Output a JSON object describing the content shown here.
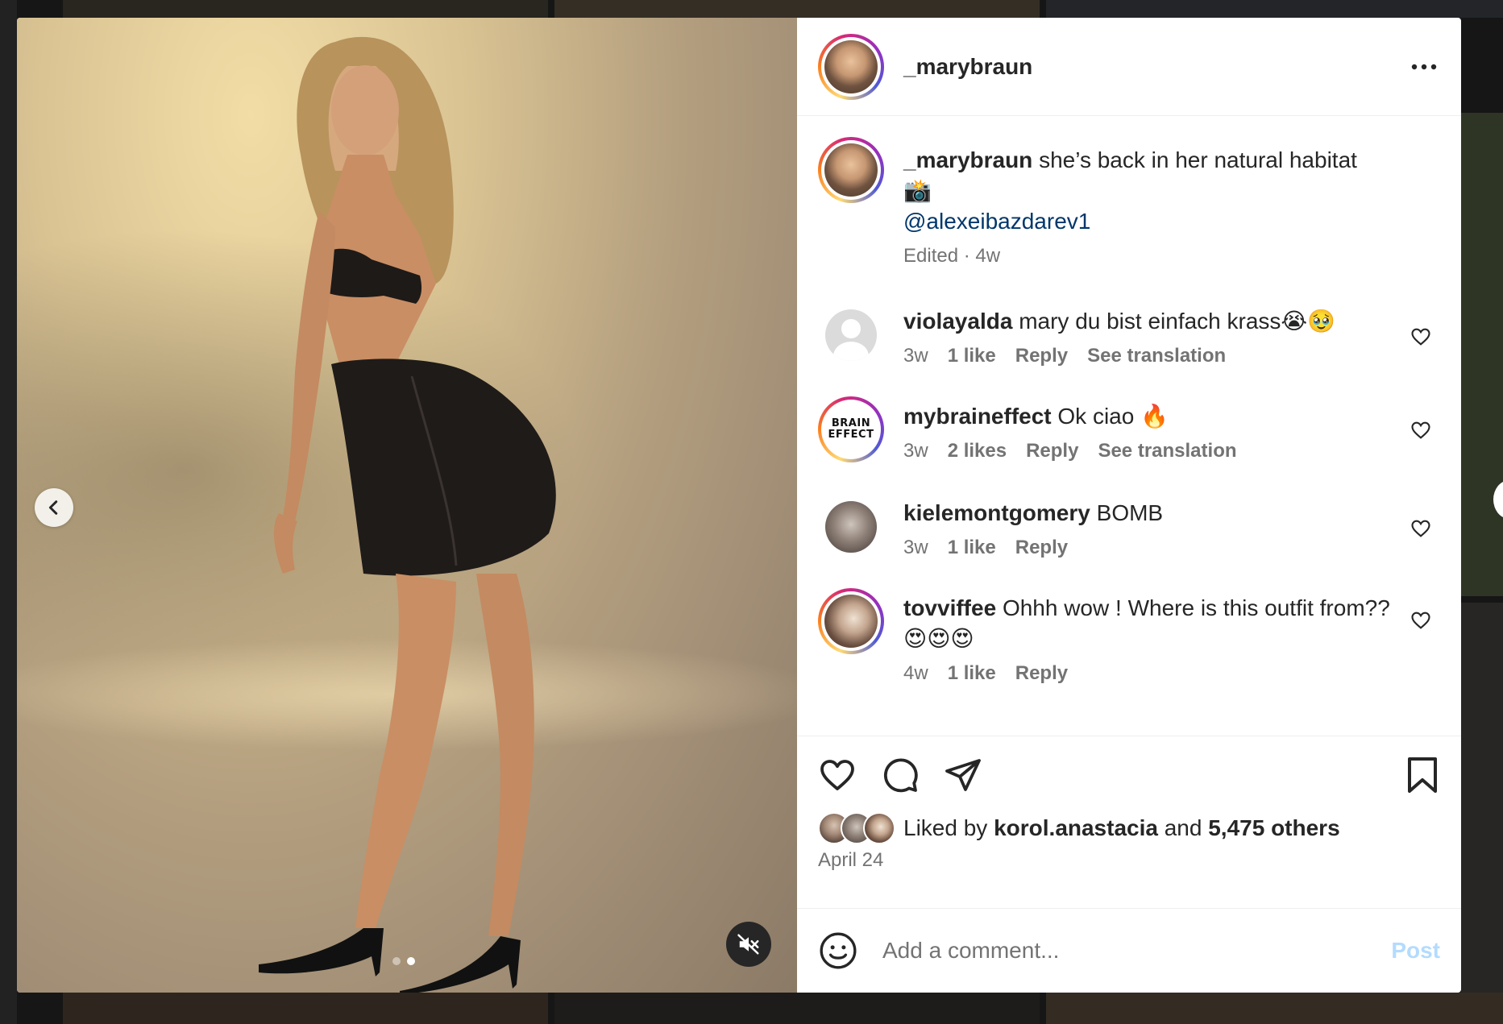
{
  "post": {
    "username": "_marybraun",
    "caption_text": "she’s back in her natural habitat",
    "caption_emoji": "📸",
    "mention": "@alexeibazdarev1",
    "edited": "Edited · 4w"
  },
  "media": {
    "mute_icon": "volume-muted-icon",
    "prev_icon": "chevron-left-icon",
    "slides_total": 2,
    "slide_active": 2
  },
  "comments": [
    {
      "user": "violayalda",
      "text": "mary du bist einfach krass😭🥹",
      "time": "3w",
      "likes": "1 like",
      "reply": "Reply",
      "translate": "See translation"
    },
    {
      "user": "mybraineffect",
      "text": "Ok ciao 🔥",
      "time": "3w",
      "likes": "2 likes",
      "reply": "Reply",
      "translate": "See translation",
      "logo_line1": "BRAIN",
      "logo_line2": "EFFECT"
    },
    {
      "user": "kielemontgomery",
      "text": "BOMB",
      "time": "3w",
      "likes": "1 like",
      "reply": "Reply"
    },
    {
      "user": "tovviffee",
      "text": "Ohhh wow ! Where is this outfit from?? 😍😍😍",
      "time": "4w",
      "likes": "1 like",
      "reply": "Reply"
    }
  ],
  "likes": {
    "prefix": "Liked by",
    "user": "korol.anastacia",
    "joiner": "and",
    "others": "5,475 others"
  },
  "date": "April 24",
  "add_comment": {
    "placeholder": "Add a comment...",
    "post_label": "Post"
  },
  "colors": {
    "mention": "#00376b",
    "meta": "#737373",
    "post_disabled": "#b3dbff"
  }
}
